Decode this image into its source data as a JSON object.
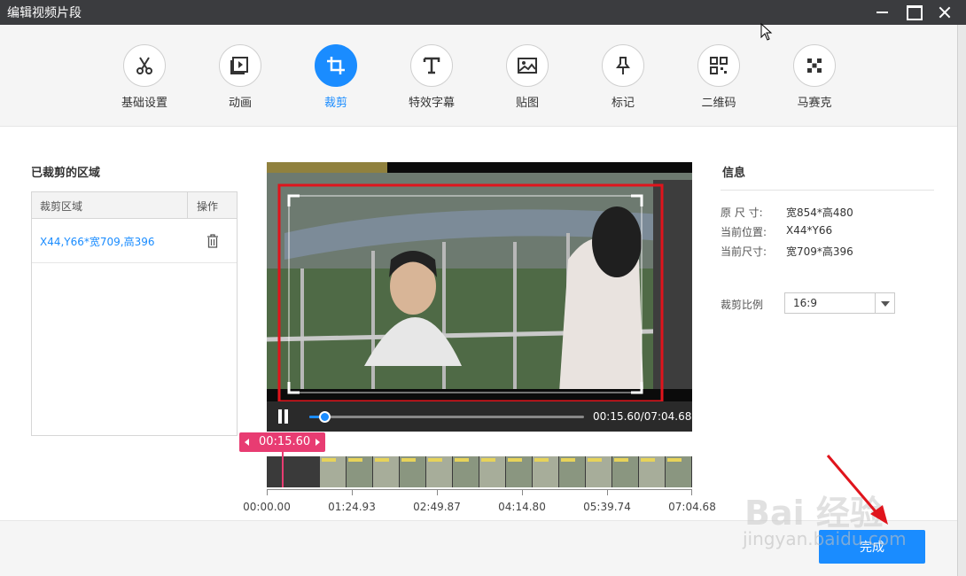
{
  "window": {
    "title": "编辑视频片段"
  },
  "toolbar": {
    "tabs": [
      {
        "label": "基础设置",
        "icon": "scissors-icon"
      },
      {
        "label": "动画",
        "icon": "film-play-icon"
      },
      {
        "label": "裁剪",
        "icon": "crop-icon",
        "active": true
      },
      {
        "label": "特效字幕",
        "icon": "text-icon"
      },
      {
        "label": "贴图",
        "icon": "image-icon"
      },
      {
        "label": "标记",
        "icon": "pin-icon"
      },
      {
        "label": "二维码",
        "icon": "qrcode-icon"
      },
      {
        "label": "马赛克",
        "icon": "mosaic-icon"
      }
    ]
  },
  "left_panel": {
    "title": "已裁剪的区域",
    "table": {
      "headers": [
        "裁剪区域",
        "操作"
      ],
      "rows": [
        {
          "region": "X44,Y66*宽709,高396",
          "action_icon": "trash-icon"
        }
      ]
    }
  },
  "player": {
    "time": "00:15.60/07:04.68",
    "progress": 0.0367,
    "state": "playing"
  },
  "timeline": {
    "playhead_label": "00:15.60",
    "ticks": [
      "00:00.00",
      "01:24.93",
      "02:49.87",
      "04:14.80",
      "05:39.74",
      "07:04.68"
    ]
  },
  "info": {
    "title": "信息",
    "items": [
      {
        "key": "原 尺 寸:",
        "value": "宽854*高480"
      },
      {
        "key": "当前位置:",
        "value": "X44*Y66"
      },
      {
        "key": "当前尺寸:",
        "value": "宽709*高396"
      }
    ],
    "ratio_label": "裁剪比例",
    "ratio_value": "16:9"
  },
  "footer": {
    "done_label": "完成"
  },
  "watermark": {
    "brand": "Bai 经验",
    "url": "jingyan.baidu.com"
  },
  "colors": {
    "accent": "#1a8cff",
    "playhead": "#e83c72",
    "crop_highlight": "#e0141c",
    "titlebar": "#3b3c3f"
  }
}
